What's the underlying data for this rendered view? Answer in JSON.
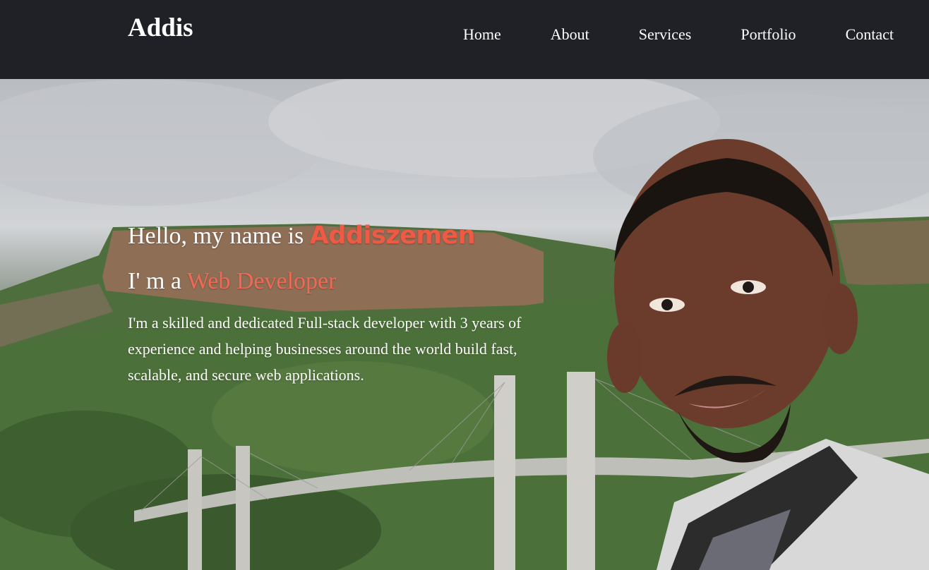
{
  "brand": "Addis",
  "nav": {
    "items": [
      {
        "label": "Home"
      },
      {
        "label": "About"
      },
      {
        "label": "Services"
      },
      {
        "label": "Portfolio"
      },
      {
        "label": "Contact"
      }
    ]
  },
  "hero": {
    "greeting_prefix": "Hello, my name is ",
    "name": "Addiszemen",
    "role_prefix": "I' m a ",
    "role": "Web Developer",
    "bio": "I'm a skilled and dedicated Full-stack developer with 3 years of experience and helping businesses around the world build fast, scalable, and secure web applications."
  },
  "colors": {
    "navbar_bg": "#1f2126",
    "accent": "#ef5a45"
  }
}
